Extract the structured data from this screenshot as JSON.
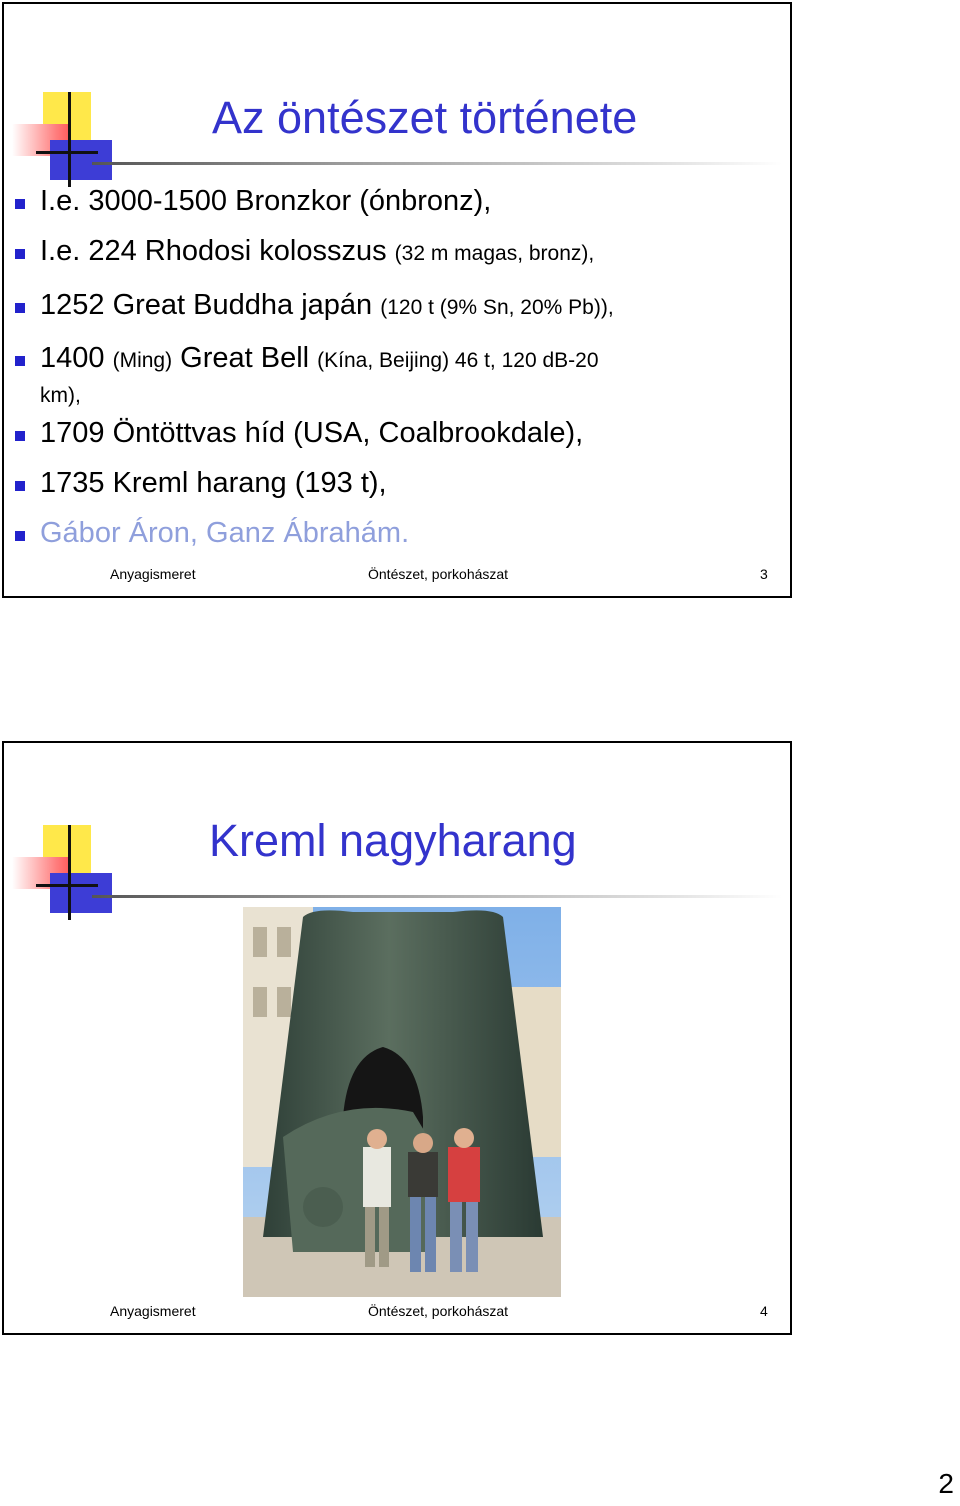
{
  "slide1": {
    "title": "Az öntészet története",
    "bullets": [
      {
        "main": "I.e. 3000-1500 Bronzkor (ónbronz),",
        "detail": ""
      },
      {
        "main": "I.e. 224 Rhodosi kolosszus",
        "detail": "(32 m magas, bronz),"
      },
      {
        "main": "1252 Great Buddha japán",
        "detail": "(120 t (9% Sn, 20% Pb)),"
      },
      {
        "main": "1400",
        "pre": "(Ming)",
        "main2": "Great Bell",
        "detail": "(Kína, Beijing) 46 t, 120 dB-20",
        "detail2": "km),"
      },
      {
        "main": "1709 Öntöttvas híd (USA, Coalbrookdale),",
        "detail": ""
      },
      {
        "main": "1735 Kreml harang (193 t),",
        "detail": ""
      },
      {
        "main": "Gábor Áron, Ganz Ábrahám.",
        "detail": ""
      }
    ],
    "footer": {
      "left": "Anyagismeret",
      "center": "Öntészet, porkohászat",
      "right": "3"
    }
  },
  "slide2": {
    "title": "Kreml nagyharang",
    "footer": {
      "left": "Anyagismeret",
      "center": "Öntészet, porkohászat",
      "right": "4"
    }
  },
  "page_number": "2"
}
